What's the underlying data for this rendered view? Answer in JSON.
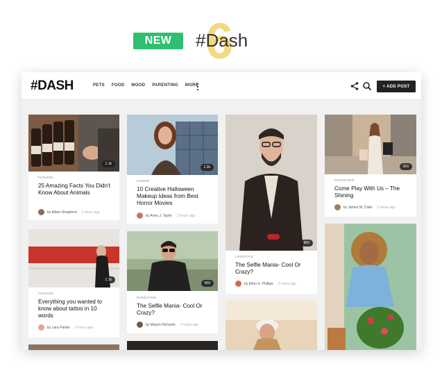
{
  "promo": {
    "badge": "NEW",
    "version": "6",
    "title": "#Dash"
  },
  "navbar": {
    "logo": "#DASH",
    "links": [
      "PETS",
      "FOOD",
      "MOOD",
      "PARENTING",
      "MORE"
    ],
    "add_post": "+ ADD POST",
    "icons": [
      "share-icon",
      "search-icon",
      "more-vertical-icon"
    ]
  },
  "cards": [
    {
      "category": "FASHION",
      "title": "25 Amazing Facts You Didn't Know About Animals",
      "by": "by",
      "author": "Albert Shepherd",
      "time": "2 hours ago",
      "shares": "1.1k"
    },
    {
      "category": "HUMOR",
      "title": "10 Creative Halloween Makeup Ideas from Best Horror Movies",
      "by": "by",
      "author": "Anna J. Taylor",
      "time": "2 hours ago",
      "shares": "1.2k"
    },
    {
      "category": "LIFESTYLE",
      "title": "The Selfie Mania- Cool Or Crazy?",
      "by": "by",
      "author": "Ellen G. Phillips",
      "time": "2 hours ago",
      "shares": "900"
    },
    {
      "category": "PARENTING",
      "title": "Come Play With Us – The Shining",
      "by": "by",
      "author": "James M. Clark",
      "time": "2 hours ago",
      "shares": "910"
    },
    {
      "category": "FASHION",
      "title": "Everything you wanted to know about tattoo in 10 words",
      "by": "by",
      "author": "Lara Parker",
      "time": "2 hours ago",
      "shares": "1.1k"
    },
    {
      "category": "PARENTING",
      "title": "The Selfie Mania- Cool Or Crazy?",
      "by": "by",
      "author": "Mason Richards",
      "time": "2 hours ago",
      "shares": "900"
    }
  ],
  "colors": {
    "badge_green": "#2fbf71",
    "version_yellow": "#f2d36b",
    "navbar_dark": "#222222"
  }
}
